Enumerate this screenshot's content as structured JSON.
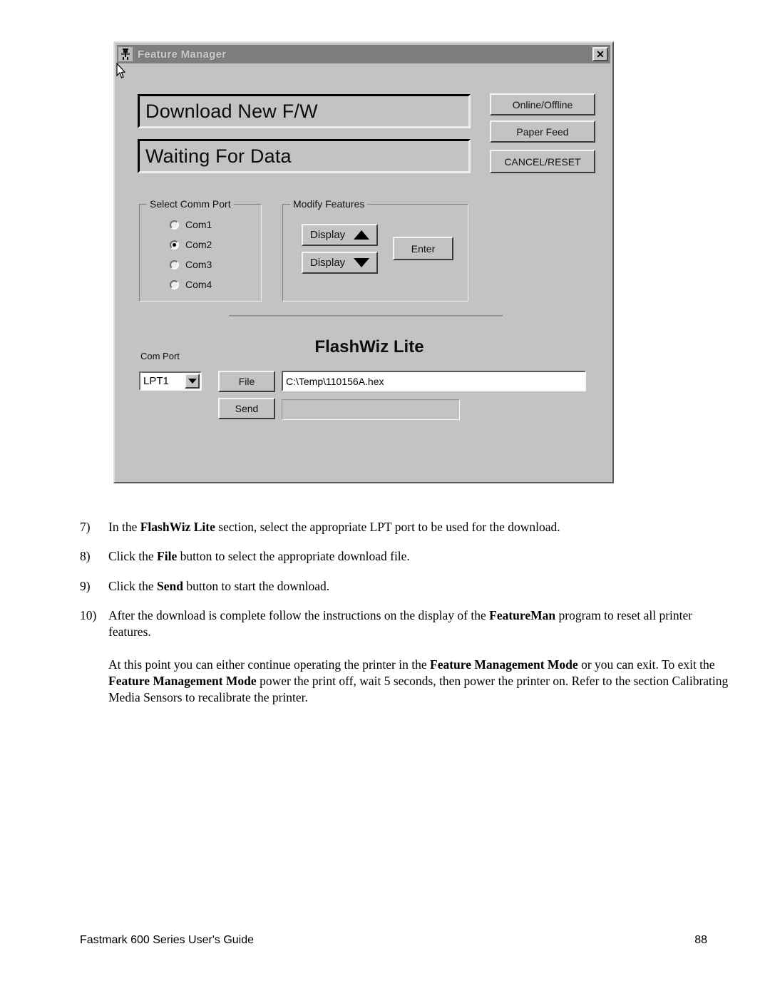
{
  "dialog": {
    "title": "Feature Manager",
    "title_icon": "printer-figure-icon",
    "close_label": "✕",
    "display_line1": "Download New F/W",
    "display_line2": "Waiting For Data",
    "buttons": {
      "online_offline": "Online/Offline",
      "paper_feed": "Paper Feed",
      "cancel_reset": "CANCEL/RESET"
    },
    "select_comm_port": {
      "legend": "Select Comm Port",
      "options": [
        {
          "label": "Com1",
          "checked": false
        },
        {
          "label": "Com2",
          "checked": true
        },
        {
          "label": "Com3",
          "checked": false
        },
        {
          "label": "Com4",
          "checked": false
        }
      ]
    },
    "modify_features": {
      "legend": "Modify Features",
      "display_up": "Display",
      "display_down": "Display",
      "enter": "Enter"
    },
    "flashwiz": {
      "title": "FlashWiz Lite",
      "com_port_label": "Com Port",
      "com_port_value": "LPT1",
      "file_button": "File",
      "send_button": "Send",
      "file_path": "C:\\Temp\\110156A.hex",
      "status_value": ""
    },
    "colors": {
      "face": "#c3c3c3",
      "titlebar": "#7e7e7e",
      "title_text": "#c9c9c9",
      "field_bg": "#ffffff"
    }
  },
  "document": {
    "steps": [
      {
        "num": "7)",
        "parts": [
          {
            "t": "In the ",
            "b": false
          },
          {
            "t": "FlashWiz Lite",
            "b": true
          },
          {
            "t": " section, select the appropriate LPT port to be used for the download.",
            "b": false
          }
        ]
      },
      {
        "num": "8)",
        "parts": [
          {
            "t": "Click the ",
            "b": false
          },
          {
            "t": "File",
            "b": true
          },
          {
            "t": " button to select the appropriate download file.",
            "b": false
          }
        ]
      },
      {
        "num": "9)",
        "parts": [
          {
            "t": "Click the ",
            "b": false
          },
          {
            "t": "Send",
            "b": true
          },
          {
            "t": " button to start the download.",
            "b": false
          }
        ]
      },
      {
        "num": "10)",
        "parts": [
          {
            "t": "After the download is complete follow the instructions on the display of the ",
            "b": false
          },
          {
            "t": "FeatureMan",
            "b": true
          },
          {
            "t": " program to reset all printer features.",
            "b": false
          }
        ]
      }
    ],
    "paragraph": [
      {
        "t": "At this point you can either continue operating the printer in the ",
        "b": false
      },
      {
        "t": "Feature Management Mode",
        "b": true
      },
      {
        "t": " or you can exit. To exit the ",
        "b": false
      },
      {
        "t": "Feature Management Mode",
        "b": true
      },
      {
        "t": " power the print off, wait 5 seconds, then power the printer on. Refer to the section Calibrating Media Sensors to recalibrate the printer.",
        "b": false
      }
    ]
  },
  "footer": {
    "left": "Fastmark 600 Series User's Guide",
    "right": "88"
  }
}
